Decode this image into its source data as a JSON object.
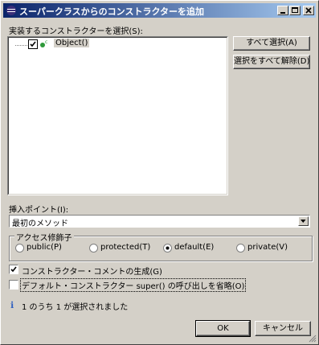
{
  "window": {
    "title": "スーパークラスからのコンストラクターを追加",
    "icon": "eclipse-icon",
    "controls": [
      "minimize",
      "maximize",
      "close"
    ]
  },
  "constructors": {
    "label": "実装するコンストラクターを選択(S):",
    "items": [
      {
        "label": "Object()",
        "checked": true,
        "icon": "constructor-icon"
      }
    ]
  },
  "buttons": {
    "select_all": "すべて選択(A)",
    "deselect_all": "選択をすべて解除(D)",
    "ok": "OK",
    "cancel": "キャンセル"
  },
  "insertion": {
    "label": "挿入ポイント(I):",
    "value": "最初のメソッド"
  },
  "access": {
    "title": "アクセス修飾子",
    "options": [
      {
        "label": "public(P)",
        "selected": false
      },
      {
        "label": "protected(T)",
        "selected": false
      },
      {
        "label": "default(E)",
        "selected": true
      },
      {
        "label": "private(V)",
        "selected": false
      }
    ]
  },
  "options": {
    "generate_comments": {
      "label": "コンストラクター・コメントの生成(G)",
      "checked": true
    },
    "omit_super": {
      "label": "デフォルト・コンストラクター super() の呼び出しを省略(O)",
      "checked": false
    }
  },
  "status": {
    "text": "1 のうち 1 が選択されました",
    "icon": "info-icon"
  },
  "colors": {
    "title_bar_start": "#0a246a",
    "title_bar_end": "#a6caf0",
    "face": "#d4d0c8",
    "selected_item_bg": "#d4d0c8"
  }
}
